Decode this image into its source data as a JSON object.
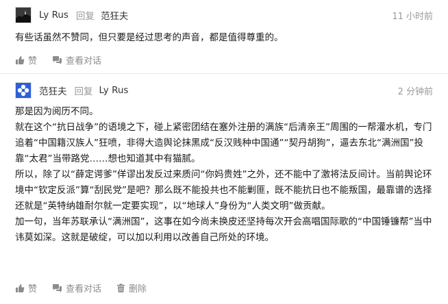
{
  "comments": [
    {
      "author": "Ly Rus",
      "reply_label": "回复",
      "reply_to": "范狂夫",
      "time": "11 小时前",
      "avatar_icon": "silhouette-landscape-icon",
      "paragraphs": [
        "有些话虽然不赞同，但只要是经过思考的声音，都是值得尊重的。"
      ],
      "actions": {
        "like": "赞",
        "view_thread": "查看对话"
      }
    },
    {
      "author": "范狂夫",
      "reply_label": "回复",
      "reply_to": "Ly Rus",
      "time": "2 分钟前",
      "avatar_icon": "blue-flower-icon",
      "paragraphs": [
        "那是因为阅历不同。",
        "就在这个“抗日战争”的语境之下，碰上紧密团结在塞外注册的满族“后清亲王”周围的一帮灌水机，专门追着“中国籍汉族人”狂喷，非得大造舆论抹黑成“反汉贱种中国通”“契丹胡狗”，逼去东北“满洲国”投靠“太君”当带路党……想也知道其中有猫腻。",
        "所以，除了以“薛定谔爹”佯谬出发反过来质问“你妈贵姓”之外，还不能中了激将法反间计。当前舆论环境中“钦定反派”算“刮民党”是吧？那么既不能投共也不能剿匪，既不能抗日也不能叛国，最靠谱的选择还就是“英特纳雄耐尔就一定要实现”，以“地球人”身份为“人类文明”做贡献。",
        "加一句，当年苏联承认“满洲国”，这事在如今尚未换皮还坚持每次开会高唱国际歌的“中国锤镰帮”当中讳莫如深。这就是破绽，可以加以利用以改善自己所处的环境。"
      ],
      "actions": {
        "like": "赞",
        "view_thread": "查看对话",
        "delete": "删除"
      }
    }
  ],
  "colors": {
    "meta": "#999999",
    "text": "#1a1a1a",
    "action": "#8c8c8c",
    "flower": "#2f5fd6"
  }
}
